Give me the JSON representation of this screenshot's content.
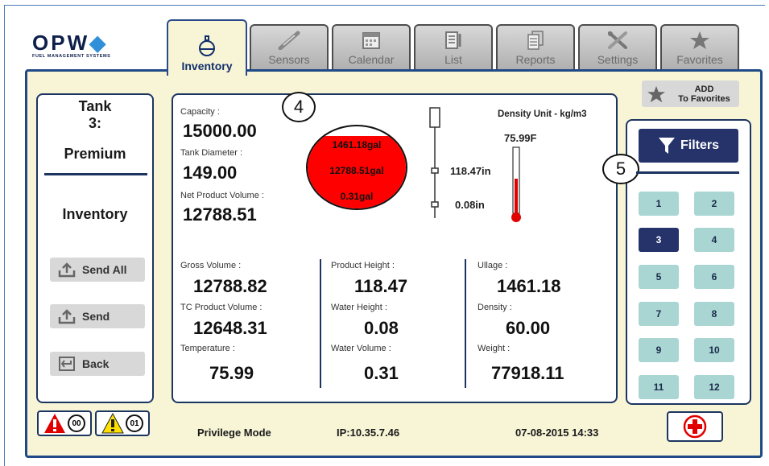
{
  "app": {
    "brand": "OPW",
    "brand_sub": "FUEL MANAGEMENT SYSTEMS"
  },
  "tabs": [
    {
      "label": "Inventory",
      "icon": "tank-icon",
      "active": true
    },
    {
      "label": "Sensors",
      "icon": "probe-icon"
    },
    {
      "label": "Calendar",
      "icon": "calendar-icon"
    },
    {
      "label": "List",
      "icon": "list-icon"
    },
    {
      "label": "Reports",
      "icon": "reports-icon"
    },
    {
      "label": "Settings",
      "icon": "tools-icon"
    },
    {
      "label": "Favorites",
      "icon": "star-icon"
    }
  ],
  "add_favorites": {
    "line1": "ADD",
    "line2": "To Favorites"
  },
  "left": {
    "tank": "Tank",
    "tank_number": "3:",
    "product": "Premium",
    "section": "Inventory",
    "send_all": "Send All",
    "send": "Send",
    "back": "Back"
  },
  "center": {
    "capacity_label": "Capacity :",
    "capacity": "15000.00",
    "diameter_label": "Tank Diameter :",
    "diameter": "149.00",
    "net_label": "Net Product Volume :",
    "net": "12788.51",
    "tank_ullage": "1461.18gal",
    "tank_product": "12788.51gal",
    "tank_water": "0.31gal",
    "density_unit": "Density Unit - kg/m3",
    "temperature_reading": "75.99F",
    "probe_product": "118.47in",
    "probe_water": "0.08in",
    "callout": "4",
    "col1": [
      {
        "label": "Gross Volume :",
        "value": "12788.82"
      },
      {
        "label": "TC Product Volume :",
        "value": "12648.31"
      },
      {
        "label": "Temperature :",
        "value": "75.99"
      }
    ],
    "col2": [
      {
        "label": "Product Height :",
        "value": "118.47"
      },
      {
        "label": "Water Height :",
        "value": "0.08"
      },
      {
        "label": "Water Volume :",
        "value": "0.31"
      }
    ],
    "col3": [
      {
        "label": "Ullage :",
        "value": "1461.18"
      },
      {
        "label": "Density :",
        "value": "60.00"
      },
      {
        "label": "Weight :",
        "value": "77918.11"
      }
    ],
    "product_level": 0.88
  },
  "filters": {
    "label": "Filters",
    "callout": "5",
    "buttons": [
      "1",
      "2",
      "3",
      "4",
      "5",
      "6",
      "7",
      "8",
      "9",
      "10",
      "11",
      "12"
    ],
    "selected": "3"
  },
  "footer": {
    "alarm_count": "00",
    "warning_count": "01",
    "mode": "Privilege Mode",
    "ip": "IP:10.35.7.46",
    "datetime": "07-08-2015 14:33"
  },
  "colors": {
    "product": "#ff0000",
    "panel": "#f7f5d6",
    "border": "#1c3560",
    "filter_btn": "#a9d6d3",
    "filter_selected": "#25336a"
  }
}
